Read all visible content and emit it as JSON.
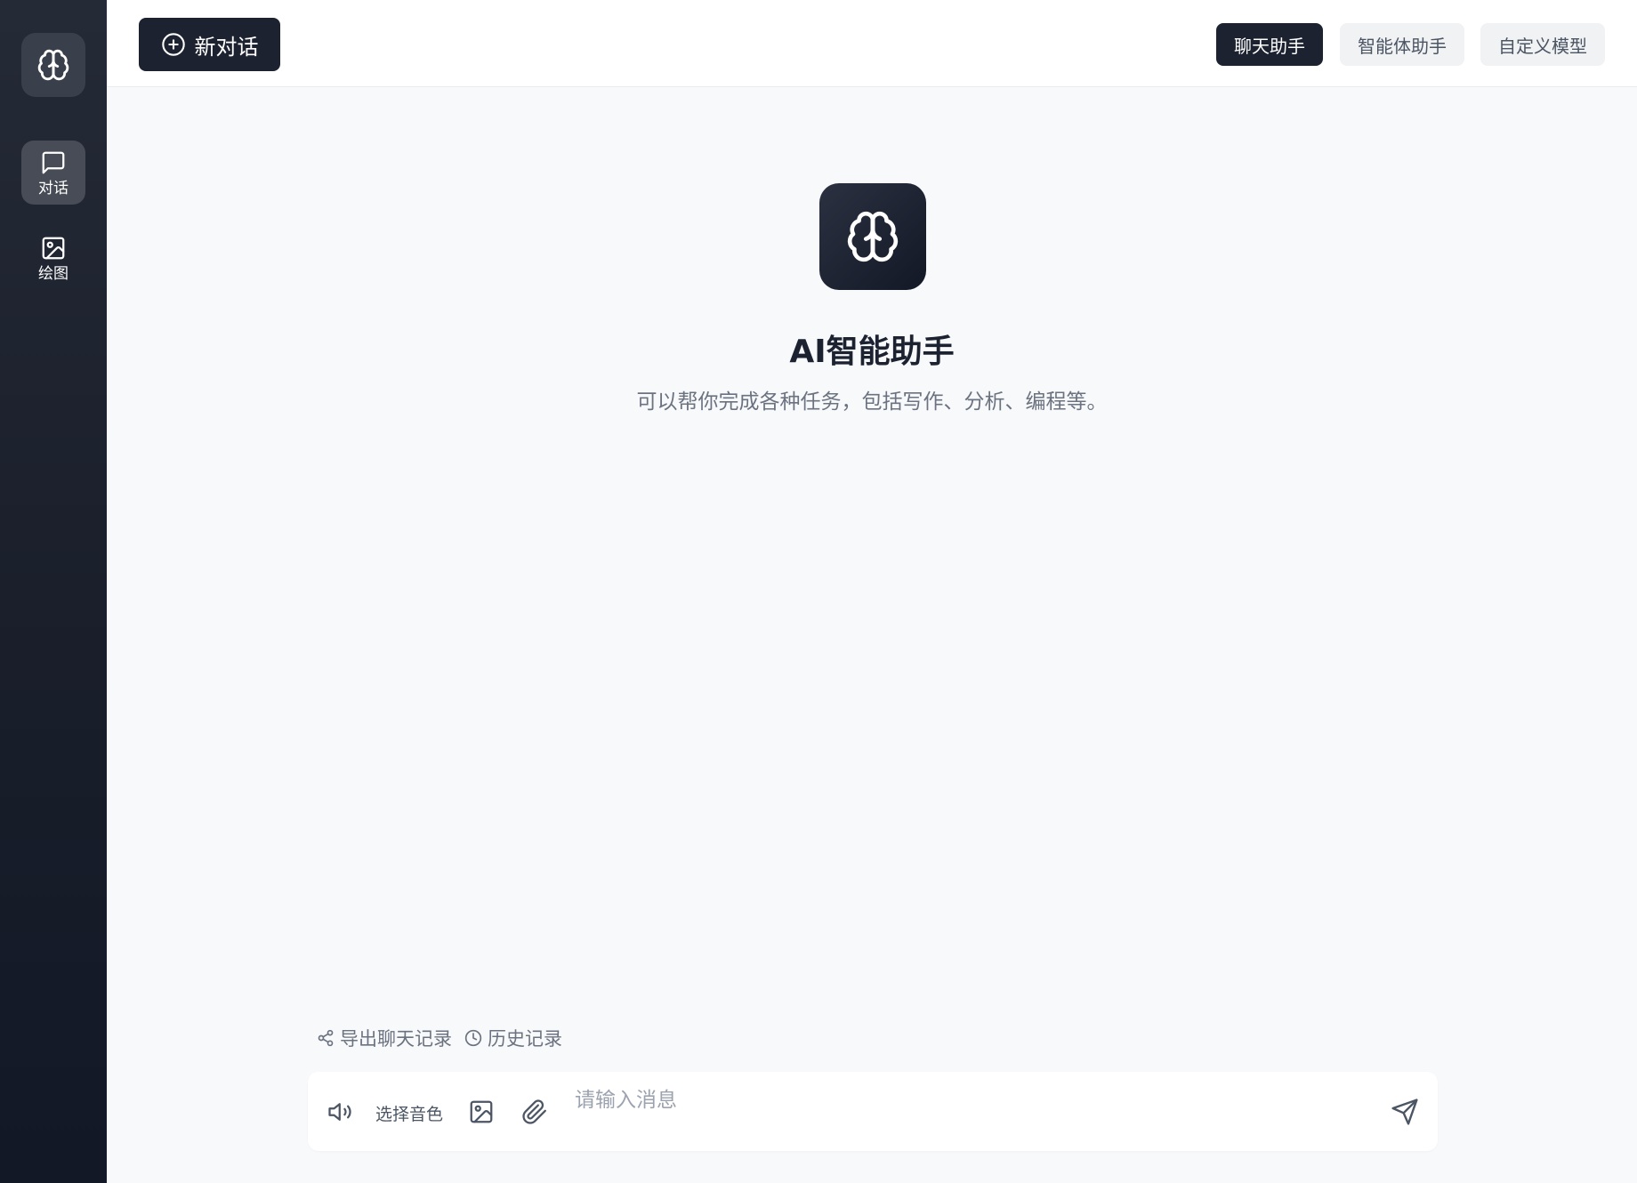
{
  "sidebar": {
    "logo_icon": "brain-icon",
    "items": [
      {
        "label": "对话",
        "icon": "message-square-icon",
        "active": true
      },
      {
        "label": "绘图",
        "icon": "image-icon",
        "active": false
      }
    ]
  },
  "topbar": {
    "new_chat_label": "新对话",
    "new_chat_icon": "plus-circle-icon",
    "tabs": [
      {
        "label": "聊天助手",
        "active": true
      },
      {
        "label": "智能体助手",
        "active": false
      },
      {
        "label": "自定义模型",
        "active": false
      }
    ]
  },
  "hero": {
    "icon": "brain-icon",
    "title": "AI智能助手",
    "subtitle": "可以帮你完成各种任务，包括写作、分析、编程等。"
  },
  "actions": {
    "export_label": "导出聊天记录",
    "export_icon": "share-icon",
    "history_label": "历史记录",
    "history_icon": "clock-icon"
  },
  "composer": {
    "voice_icon": "speaker-icon",
    "voice_label": "选择音色",
    "image_icon": "image-icon",
    "attach_icon": "paperclip-icon",
    "placeholder": "请输入消息",
    "value": "",
    "send_icon": "send-icon"
  },
  "colors": {
    "sidebar_bg": "#1a1f2b",
    "primary_dark": "#1c2230",
    "page_bg": "#f8f9fb",
    "muted_text": "#6b7280"
  }
}
